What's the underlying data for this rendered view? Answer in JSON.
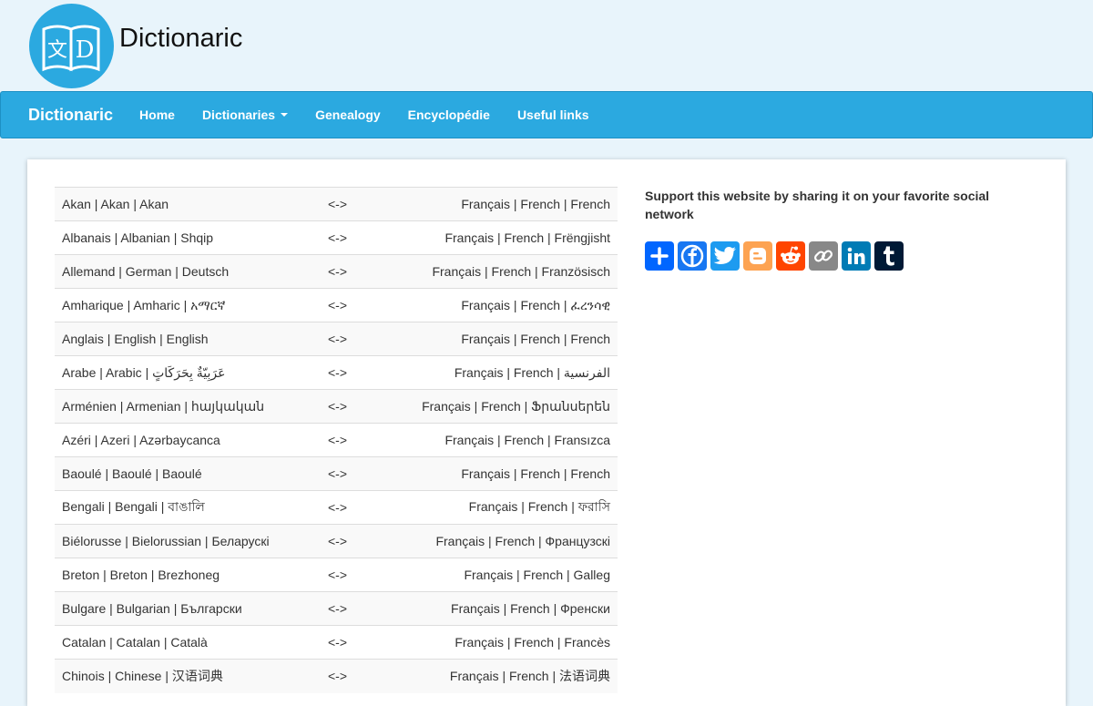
{
  "brand": {
    "title": "Dictionaric",
    "logo_glyph_left": "文",
    "logo_glyph_right": "D"
  },
  "nav": {
    "brand": "Dictionaric",
    "items": [
      {
        "label": "Home",
        "dropdown": false
      },
      {
        "label": "Dictionaries",
        "dropdown": true
      },
      {
        "label": "Genealogy",
        "dropdown": false
      },
      {
        "label": "Encyclopédie",
        "dropdown": false
      },
      {
        "label": "Useful links",
        "dropdown": false
      }
    ]
  },
  "dictionaries": {
    "arrow": "<->",
    "rows": [
      {
        "source": "Akan | Akan | Akan",
        "target": "Français | French | French"
      },
      {
        "source": "Albanais  | Albanian | Shqip",
        "target": "Français | French | Frëngjisht"
      },
      {
        "source": "Allemand  | German | Deutsch",
        "target": "Français | French | Französisch"
      },
      {
        "source": "Amharique  | Amharic | አማርኛ",
        "target": "Français | French | ፈረንሳዊ"
      },
      {
        "source": "Anglais  | English | English",
        "target": "Français | French | French"
      },
      {
        "source": "Arabe  | Arabic | عَرَبِيّةٌ بِحَرَكَاتٍ",
        "target": "Français | French | الفرنسية"
      },
      {
        "source": "Arménien  | Armenian | հայկական",
        "target": "Français | French | Ֆրանսերեն"
      },
      {
        "source": "Azéri  | Azeri | Azərbaycanca",
        "target": "Français | French | Fransızca"
      },
      {
        "source": "Baoulé | Baoulé | Baoulé",
        "target": "Français | French | French"
      },
      {
        "source": "Bengali | Bengali | বাঙালি",
        "target": "Français | French | ফরাসি"
      },
      {
        "source": "Biélorusse | Bielorussian | Беларускі",
        "target": "Français | French | Французскі"
      },
      {
        "source": "Breton  | Breton | Brezhoneg",
        "target": "Français | French | Galleg"
      },
      {
        "source": "Bulgare  | Bulgarian | Български",
        "target": "Français | French | Френски"
      },
      {
        "source": "Catalan | Catalan | Català",
        "target": "Français | French | Francès"
      },
      {
        "source": "Chinois  | Chinese | 汉语词典",
        "target": "Français | French | 法语词典"
      }
    ]
  },
  "share": {
    "text": "Support this website by sharing it on your favorite social network",
    "buttons": [
      {
        "name": "share",
        "color": "#0166ff"
      },
      {
        "name": "facebook",
        "color": "#1877f2"
      },
      {
        "name": "twitter",
        "color": "#1d9bf0"
      },
      {
        "name": "blogger",
        "color": "#fda352"
      },
      {
        "name": "reddit",
        "color": "#ff4500"
      },
      {
        "name": "copy-link",
        "color": "#888888"
      },
      {
        "name": "linkedin",
        "color": "#007bb5"
      },
      {
        "name": "tumblr",
        "color": "#001935"
      }
    ]
  }
}
